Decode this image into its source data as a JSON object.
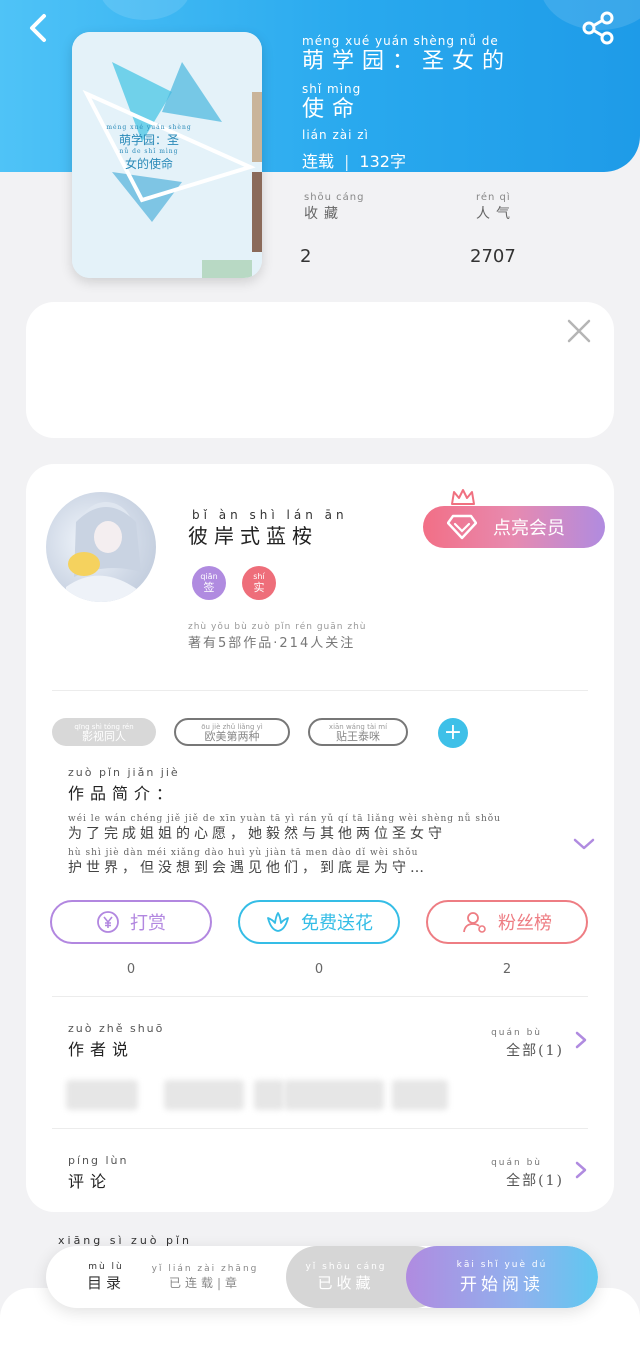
{
  "colors": {
    "header": "#29a9ee",
    "vip_start": "#f26f86",
    "vip_end": "#b08be0",
    "reward": "#b287e0",
    "flower": "#35bde6",
    "fans": "#ee7d83"
  },
  "header": {
    "back_icon": "chevron-left-icon",
    "share_icon": "share-icon",
    "title_pinyin_1": "méng  xué  yuán       shèng  nǚ   de",
    "title_line_1": "萌学园：圣女的",
    "title_pinyin_2": "shǐ  mìng",
    "title_line_2": "使命",
    "status_pinyin": "lián  zài                  zì",
    "status": "连载",
    "word_count": "132字"
  },
  "cover": {
    "title_pinyin_1": "méng  xué  yuán     shèng",
    "title_line_1": "萌学园：圣",
    "title_pinyin_2": "nǚ  de  shǐ  mìng",
    "title_line_2": "女的使命"
  },
  "stats": {
    "favorites_pinyin": "shōu cáng",
    "favorites_label": "收藏",
    "favorites_value": "2",
    "popularity_pinyin": "rén  qì",
    "popularity_label": "人气",
    "popularity_value": "2707"
  },
  "author": {
    "name_pinyin": "bǐ   àn   shì  lán  ān",
    "name": "彼岸式蓝桉",
    "badge_1_pinyin": "qiān",
    "badge_1": "签",
    "badge_2_pinyin": "shí",
    "badge_2": "实",
    "meta_pinyin": "zhù  yǒu      bù  zuò  pǐn            rén  guān  zhù",
    "meta": "著有5部作品·214人关注",
    "vip_button": "点亮会员"
  },
  "tags": [
    {
      "pinyin": "qīng  shì  tóng  rén",
      "label": "影视同人"
    },
    {
      "pinyin": "ōu   jiè   zhǔ   liǎng   yì",
      "label": "欧美第两种"
    },
    {
      "pinyin": "xiān  wáng  tài   mí",
      "label": "贴王泰咪"
    }
  ],
  "intro": {
    "heading_pinyin": "zuò  pǐn  jiǎn  jiè",
    "heading": "作品简介：",
    "line_1_pinyin": "wéi   le   wán chéng  jiě   jiě   de   xīn  yuàn        tā    yì   rán   yǔ    qí   tā  liǎng  wèi shèng  nǚ  shǒu",
    "line_1": "为了完成姐姐的心愿，她毅然与其他两位圣女守",
    "line_2_pinyin": "hù   shì   jiè       dàn  méi xiǎng  dào  huì   yù   jiàn  tā  men        dào   dǐ   wèi  shǒu",
    "line_2": "护世界，但没想到会遇见他们，到底是为守…"
  },
  "actions": [
    {
      "label": "打赏",
      "count": "0",
      "icon": "yen-icon"
    },
    {
      "label": "免费送花",
      "count": "0",
      "icon": "flower-icon"
    },
    {
      "label": "粉丝榜",
      "count": "2",
      "icon": "user-icon"
    }
  ],
  "author_says": {
    "title_pinyin": "zuò  zhě  shuō",
    "title": "作者说",
    "more_pinyin": "quán  bù",
    "more": "全部(1)"
  },
  "comments": {
    "title_pinyin": "píng  lùn",
    "title": "评论",
    "more_pinyin": "quán  bù",
    "more": "全部(1)"
  },
  "similar_pinyin": "xiāng  sì  zuò  pǐn",
  "bottom_bar": {
    "catalog_pinyin": "mù   lù",
    "catalog": "目录",
    "status_pinyin": "yǐ  lián  zài  zhāng",
    "status": "已连载|章",
    "collected_pinyin": "yǐ  shōu cáng",
    "collected": "已收藏",
    "read_pinyin": "kāi  shǐ  yuè  dú",
    "read": "开始阅读"
  }
}
